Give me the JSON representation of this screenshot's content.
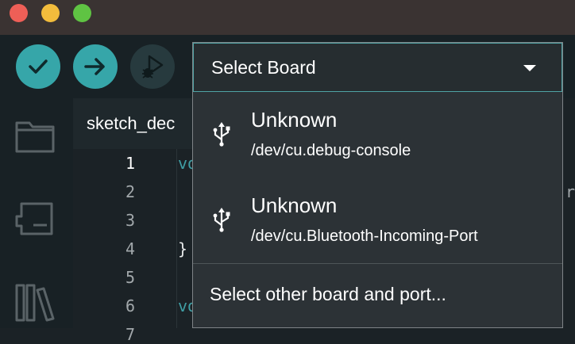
{
  "toolbar": {
    "verify_icon": "checkmark-icon",
    "upload_icon": "arrow-right-icon",
    "debug_icon": "debug-play-icon"
  },
  "editor": {
    "tab_label": "sketch_dec",
    "line_numbers": [
      "1",
      "2",
      "3",
      "4",
      "5",
      "6",
      "7"
    ],
    "code_fragments": {
      "line1": "vo",
      "line4": "}",
      "line6": "vo",
      "right_edge": "r"
    }
  },
  "board_dropdown": {
    "header_label": "Select Board",
    "items": [
      {
        "name": "Unknown",
        "port": "/dev/cu.debug-console",
        "icon": "usb-icon"
      },
      {
        "name": "Unknown",
        "port": "/dev/cu.Bluetooth-Incoming-Port",
        "icon": "usb-icon"
      }
    ],
    "footer_label": "Select other board and port..."
  },
  "colors": {
    "accent": "#36a6a9",
    "dropdown_bg": "#2c3236",
    "toolbar_bg": "#182125"
  }
}
